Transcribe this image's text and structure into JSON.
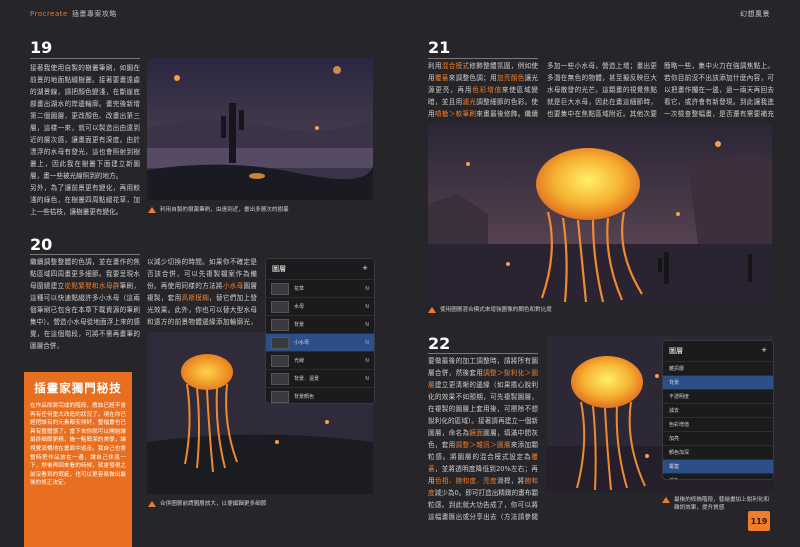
{
  "header": {
    "brand": "Procreate",
    "book": "插畫專案攻略",
    "chapter": "幻想風景"
  },
  "steps": {
    "s19": {
      "num": "19",
      "text1": "接著我使用自製的樹叢筆刷，如圖在前景的地面點綴樹叢。接著要畫遠處的湖景線，請把顏色變淺，在斷崖底部畫出湖水的岸邊輪廓。畫完後新增第二個圖層，更改顏色、改畫出第三層，這樣一來，就可以製造出由遠到近的層次感，讓畫面更有深度。由於漂浮的水母有發光，這也會照射到樹叢上，因此我在樹叢下面建立新圖層，畫一些被光線照到的地方。",
      "text2": "另外，為了讓前景更有變化，再用較淺的綠色，在樹叢四周點綴花草，加上一些枯枝，讓樹叢更有變化。",
      "caption": "利用自製的樹叢筆刷，由遠到近，畫出多層次的樹叢"
    },
    "s20": {
      "num": "20",
      "text1": "繼續調整整體的色調，並在畫作的焦點區域四周畫更多細節。我要呈現水母圍繞建立",
      "hl1": "從點繁嬰和水母群",
      "text1b": "筆刷，這種可以快速點綴許多小水母（這兩個筆刷已包含在本章下載資源的筆刷集中）。營造小水母從地面浮上來的感覺，在這個階段，可將不需再畫筆的圖層合併，",
      "text2": "以減少切換的時間。如果你不確定是否該合併，可以先複製檔案作為備份。再使用同樣的方法將",
      "hl2": "小水母",
      "text2b": "圖層複製，套用",
      "hl3": "高斯模糊",
      "text2c": "，替它們加上發光效果。此外，你也可以替大型水母和遠方的前景物體邊緣添加輪廓光，但請注意不要過量。",
      "caption": "合併圖層前請圖層放大，以便編輯更多細節"
    },
    "s21": {
      "num": "21",
      "text1a": "利用",
      "hl1": "混合模式",
      "text1b": "修飾整體氛圍，例如使用",
      "hl2": "覆蓋",
      "text1c": "來調整色調；用",
      "hl3": "加亮顏色",
      "text1d": "讓光源更亮，再用",
      "hl4": "色彩增值",
      "text1e": "來使區域變暗，並且用",
      "hl5": "濾光",
      "text1f": "調整細節的色彩。使用",
      "hl6": "噴槍＞軟筆刷",
      "text1g": "來畫最後修飾。繼續加強各部位的細節，例如可以",
      "text2": "多加一些小水母，營造上增；畫出更多潛在無色的物體，甚至擬反映巨大水母散發的光芒。這顆畫的視覺焦點就是巨大水母，因此在畫這細節時，也要集中在焦點區域附近。其他次要的區域，則要稍微",
      "text3": "簡略一些，集中火力在強調焦點上。若你目前沒不出該添加什麼內容，可以把畫作擱在一邊，過一兩天再回去看它，或許會有新發現。到此讓我進一次檢查整幅畫，是否還有需要補充的細節。",
      "caption": "使用圖層混合模式來增強圖像的顏色和對比度"
    },
    "s22": {
      "num": "22",
      "text1": "要做最後的加工調整時，請將所有圖層合併，然後套用",
      "hl1": "調整＞銳利化＞圖層",
      "text1b": "建立更清晰的邊緣（如果擔心銳利化的效果不如預期，可先複製圖層，在複製的圖層上套用後，可擦除不想銳利化的區域）。接著請再建立一個新圖層，命名為",
      "hl2": "鏡面",
      "text1c": "圖層，填滿中間灰色，套用",
      "hl3": "調整＞雜訊＞圖層",
      "text1d": "來添加顆粒感。將圖層的混合模式設定為",
      "hl4": "覆蓋",
      "text1e": "，並將透明度降低到20%左右；再用",
      "hl5": "色相．飽和度．亮度",
      "text1f": "滑桿，將",
      "hl6": "飽和度",
      "text1g": "減少為0。即可打造出精緻的畫布顆粒感。到此就大功告成了，你可以將這幅畫匯出或分享出去（方法請參閱 p.18）。",
      "caption": "最後的修飾階段，替繪畫加上銳利化和雜訊效果，提升質感"
    }
  },
  "tip": {
    "title": "插畫家獨門秘技",
    "body": "在作品即將完成的階段，應該已經不會再有任何重大改造的狀況了。現在你已經把該有的元素都安排好，整幅畫也已具有整體感了。當下來你就可以開始讓最終細節更精，施一點簡潔的美學，讓視覺流暢地在畫面中遊走。我自己也會暫時把作品放在一邊，讓自己休息一下，然後再回來看的時候，就會發現之前沒看到的瑕疵，也可以更容易做出最後的修正決定。"
  },
  "panel1": {
    "title": "圖層",
    "plus": "+",
    "layers": [
      {
        "name": "花草",
        "mark": "N"
      },
      {
        "name": "水母",
        "mark": "N"
      },
      {
        "name": "背景",
        "mark": "N"
      },
      {
        "name": "小水母",
        "mark": "N"
      },
      {
        "name": "光線",
        "mark": "N"
      },
      {
        "name": "背景．遠景",
        "mark": "N"
      },
      {
        "name": "背景顏色",
        "mark": ""
      }
    ]
  },
  "panel2": {
    "title": "圖層",
    "plus": "+",
    "group_label": "雜訊層",
    "selected_label": "背景",
    "menu": [
      "不透明度",
      "減去",
      "色彩增值",
      "加亮",
      "顏色加深",
      "覆蓋",
      "濾色",
      "柔光"
    ],
    "selected_menu": "覆蓋"
  },
  "page": "119"
}
